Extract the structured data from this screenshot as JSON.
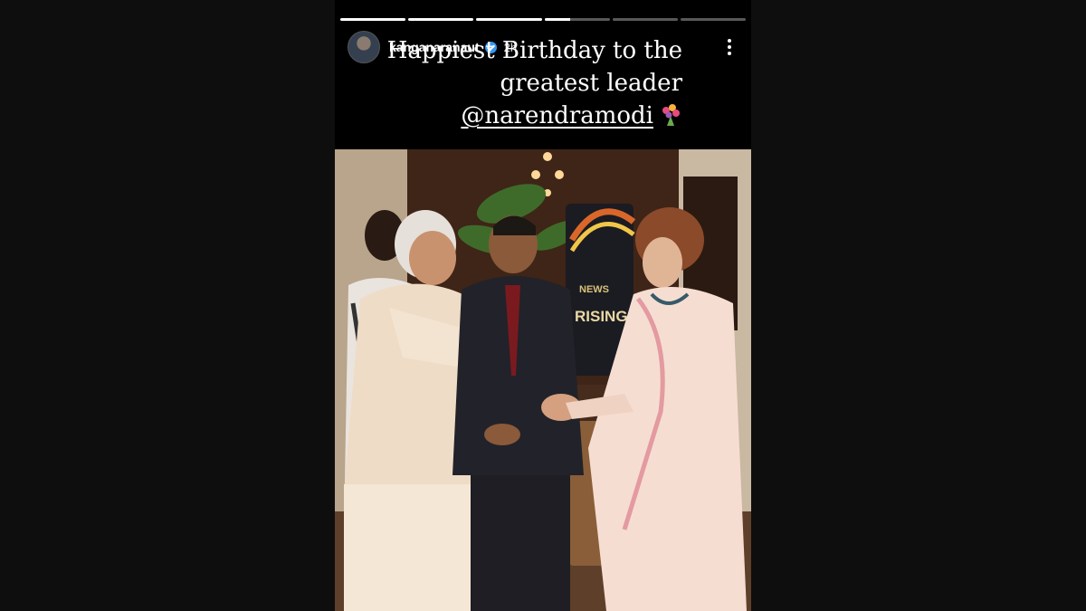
{
  "story": {
    "progress_segments": [
      1,
      1,
      1,
      0.4,
      0,
      0
    ],
    "user": {
      "name": "kanganaranaut",
      "time": "2h",
      "verified": true
    },
    "caption": {
      "line1": "Happiest Birthday to the",
      "line2": "greatest leader",
      "mention": "@narendramodi"
    },
    "icons": {
      "more": "more-options-icon",
      "verified": "verified-badge-icon",
      "emoji": "bouquet-emoji-icon"
    },
    "photo": {
      "sign_text": "RISING INDIA",
      "sign_prefix": "NEWS"
    }
  }
}
